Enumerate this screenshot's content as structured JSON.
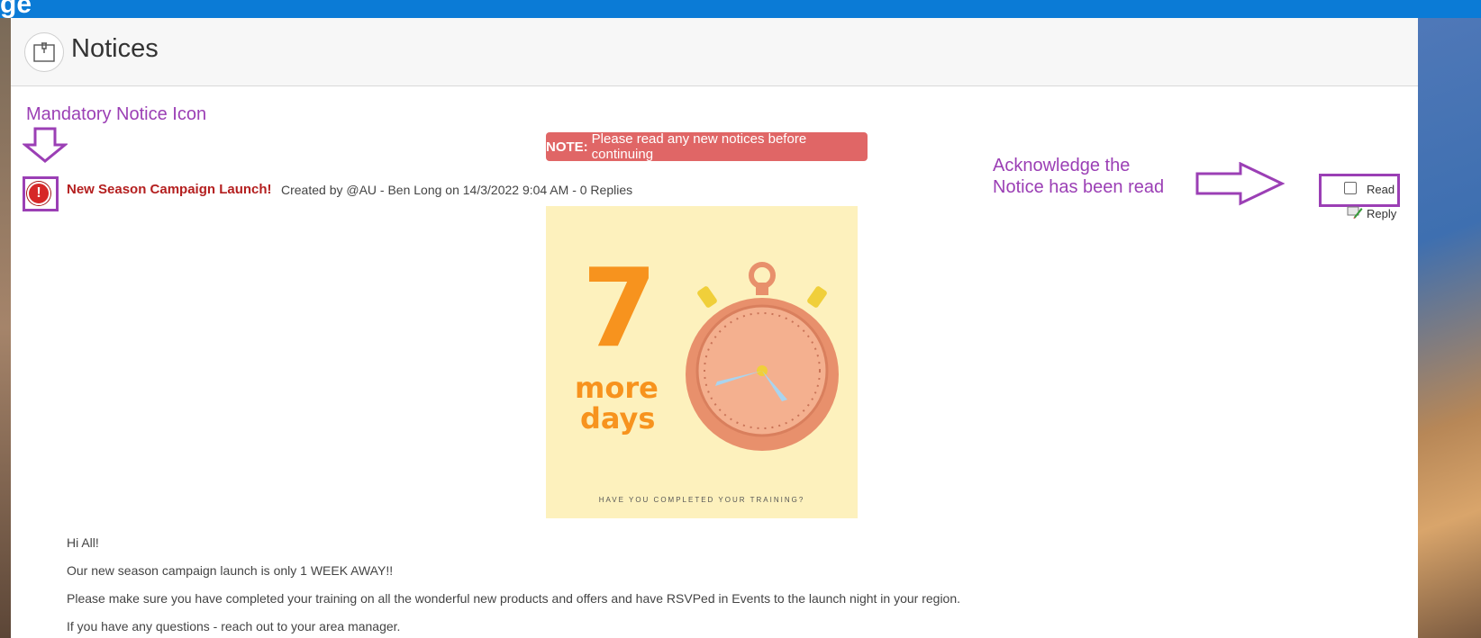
{
  "app": {
    "logo_fragment": "ge"
  },
  "header": {
    "title": "Notices"
  },
  "annotations": {
    "mandatory_icon": "Mandatory Notice Icon",
    "acknowledge_line1": "Acknowledge the",
    "acknowledge_line2": "Notice has been read"
  },
  "banner": {
    "prefix": "NOTE:",
    "text": "Please read any new notices before continuing"
  },
  "notice": {
    "title": "New Season Campaign Launch!",
    "meta": "Created by @AU - Ben Long on 14/3/2022 9:04 AM - 0 Replies",
    "read_label": "Read",
    "read_checked": false,
    "reply_label": "Reply",
    "image": {
      "number": "7",
      "line1": "more",
      "line2": "days",
      "caption": "HAVE YOU COMPLETED YOUR TRAINING?"
    },
    "body": [
      "Hi All!",
      "Our new season campaign launch is only 1 WEEK AWAY!!",
      "Please make sure you have completed your training on all the wonderful new products and offers and have RSVPed in Events to the launch night in your region.",
      "If you have any questions - reach out to your area manager."
    ]
  },
  "colors": {
    "topbar": "#0b7bd6",
    "annotation": "#9b3fb5",
    "banner": "#e06666",
    "notice_title": "#b41f1f",
    "poster_bg": "#fdf1bd",
    "poster_text": "#f7931e"
  },
  "icons": {
    "header": "pin-notice-icon",
    "mandatory": "exclamation-icon",
    "reply": "reply-pencil-icon"
  }
}
